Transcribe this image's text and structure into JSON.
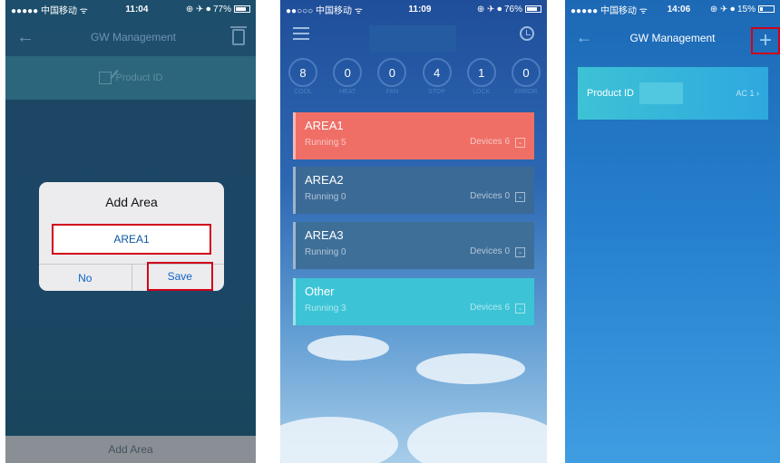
{
  "screen1": {
    "status": {
      "carrier": "●●●●● 中国移动 ᯤ",
      "time": "11:04",
      "battery": "⊕ ✈ ⏺ 77%"
    },
    "title": "GW Management",
    "product_label": "Product ID",
    "dialog": {
      "title": "Add Area",
      "input_value": "AREA1",
      "no_label": "No",
      "save_label": "Save"
    },
    "bottom_button": "Add Area"
  },
  "screen2": {
    "status": {
      "carrier": "●●○○○ 中国移动 ᯤ",
      "time": "11:09",
      "battery": "⊕ ✈ ⏺ 76%"
    },
    "counters": [
      {
        "value": "8",
        "label": "COOL"
      },
      {
        "value": "0",
        "label": "HEAT"
      },
      {
        "value": "0",
        "label": "FAN"
      },
      {
        "value": "4",
        "label": "STOP"
      },
      {
        "value": "1",
        "label": "LOCK"
      },
      {
        "value": "0",
        "label": "ERROR"
      }
    ],
    "areas": [
      {
        "name": "AREA1",
        "running": "Running 5",
        "devices": "Devices 6"
      },
      {
        "name": "AREA2",
        "running": "Running 0",
        "devices": "Devices 0"
      },
      {
        "name": "AREA3",
        "running": "Running 0",
        "devices": "Devices 0"
      },
      {
        "name": "Other",
        "running": "Running 3",
        "devices": "Devices 6"
      }
    ]
  },
  "screen3": {
    "status": {
      "carrier": "●●●●● 中国移动 ᯤ",
      "time": "14:06",
      "battery": "⊕ ✈ ⏺ 15%"
    },
    "title": "GW Management",
    "add_symbol": "+",
    "product_label": "Product ID",
    "product_value": "AC 1",
    "chevron": "›"
  },
  "colors": {
    "highlight": "#d0021b",
    "area1": "#ef6f67",
    "other": "#3cc4d6"
  }
}
